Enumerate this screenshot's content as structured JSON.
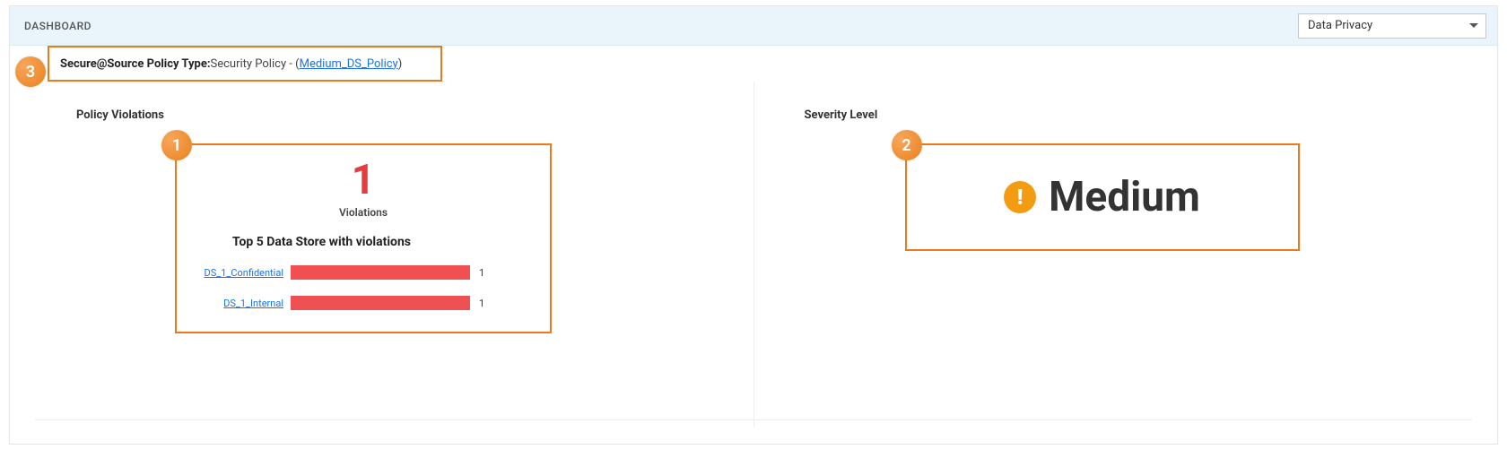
{
  "header": {
    "title": "DASHBOARD",
    "selector_value": "Data Privacy"
  },
  "subtitle": {
    "prefix": "Secure@Source Policy Type:",
    "policy_label": " Security Policy - ( ",
    "policy_link": "Medium_DS_Policy",
    "suffix": " )"
  },
  "policy_violations": {
    "heading": "Policy Violations",
    "count": "1",
    "count_label": "Violations",
    "sub_heading": "Top 5 Data Store with violations",
    "rows": [
      {
        "label": "DS_1_Confidential",
        "value": "1"
      },
      {
        "label": "DS_1_Internal",
        "value": "1"
      }
    ]
  },
  "severity": {
    "heading": "Severity Level",
    "icon_glyph": "!",
    "level": "Medium"
  },
  "callouts": {
    "c1": "1",
    "c2": "2",
    "c3": "3"
  },
  "chart_data": {
    "type": "bar",
    "orientation": "horizontal",
    "title": "Top 5 Data Store with violations",
    "categories": [
      "DS_1_Confidential",
      "DS_1_Internal"
    ],
    "values": [
      1,
      1
    ],
    "xlabel": "",
    "ylabel": "",
    "xlim": [
      0,
      1
    ]
  }
}
